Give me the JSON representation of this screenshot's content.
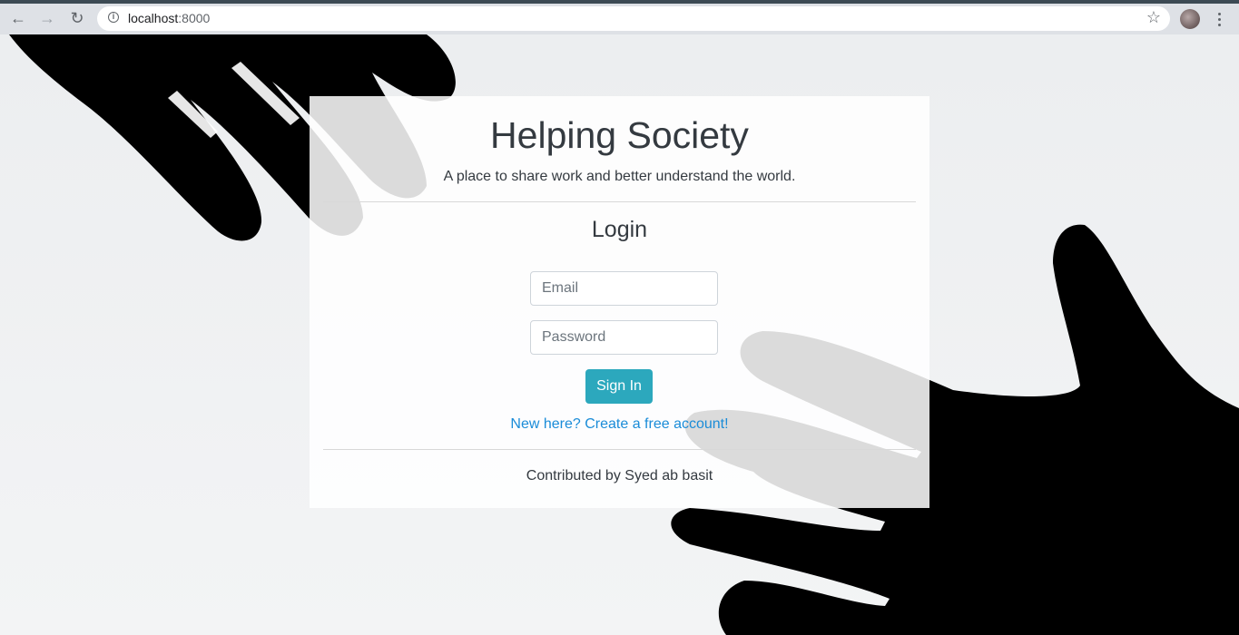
{
  "browser": {
    "url_host": "localhost",
    "url_port": ":8000"
  },
  "header": {
    "title": "Helping Society",
    "tagline": "A place to share work and better understand the world."
  },
  "login": {
    "heading": "Login",
    "email_placeholder": "Email",
    "password_placeholder": "Password",
    "submit_label": "Sign In",
    "signup_link": "New here? Create a free account!"
  },
  "footer": {
    "text": "Contributed by Syed ab basit"
  },
  "colors": {
    "accent": "#2ca8bd",
    "link": "#1a8cd8",
    "text": "#343a40"
  }
}
